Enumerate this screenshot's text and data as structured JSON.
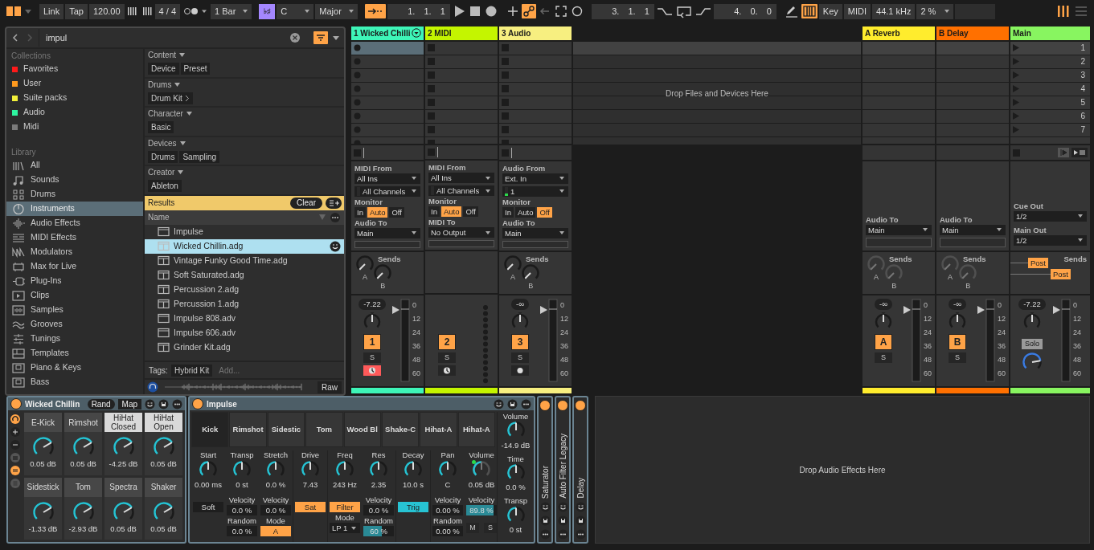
{
  "transport": [
    {
      "items": [
        {
          "kind": "icon",
          "on": true
        },
        {
          "kind": "icon"
        }
      ]
    },
    {
      "items": [
        {
          "kind": "button",
          "label": "Link"
        },
        {
          "kind": "button",
          "label": "Tap"
        },
        {
          "kind": "field",
          "label": "120.00"
        },
        {
          "kind": "icon"
        },
        {
          "kind": "icon"
        },
        {
          "kind": "field",
          "label": "4 / 4"
        },
        {
          "kind": "icon"
        },
        {
          "kind": "dropdown",
          "label": "1 Bar"
        }
      ]
    },
    {
      "items": [
        {
          "kind": "scale",
          "label": "♭♯",
          "on": true
        },
        {
          "kind": "dropdown",
          "label": "C"
        },
        {
          "kind": "dropdown",
          "label": "Major"
        }
      ]
    },
    {
      "items": [
        {
          "kind": "icon",
          "on": true
        },
        {
          "kind": "position",
          "label": "1. 1. 1"
        },
        {
          "kind": "icon"
        },
        {
          "kind": "icon"
        },
        {
          "kind": "icon"
        }
      ]
    },
    {
      "items": [
        {
          "kind": "icon"
        },
        {
          "kind": "icon",
          "on": true
        },
        {
          "kind": "icon"
        },
        {
          "kind": "icon"
        },
        {
          "kind": "icon"
        }
      ]
    },
    {
      "items": [
        {
          "kind": "position",
          "label": "3. 1. 1"
        },
        {
          "kind": "icon"
        },
        {
          "kind": "icon"
        },
        {
          "kind": "icon"
        },
        {
          "kind": "position",
          "label": "4. 0. 0"
        }
      ]
    },
    {
      "items": [
        {
          "kind": "icon"
        },
        {
          "kind": "icon",
          "on": true
        },
        {
          "kind": "button",
          "label": "Key"
        },
        {
          "kind": "button",
          "label": "MIDI"
        },
        {
          "kind": "field",
          "label": "44.1 kHz"
        },
        {
          "kind": "dropdown",
          "label": "2 %"
        },
        {
          "kind": "blank"
        }
      ]
    },
    {
      "items": [
        {
          "kind": "icon",
          "on": true
        },
        {
          "kind": "icon"
        }
      ]
    }
  ],
  "browser": {
    "search": {
      "value": "impul"
    },
    "filter_toggle": {
      "on": true
    },
    "collections": {
      "title": "Collections",
      "items": [
        {
          "label": "Favorites",
          "color": "#ff1a1a"
        },
        {
          "label": "User",
          "color": "#ff9a1e"
        },
        {
          "label": "Suite packs",
          "color": "#f2f03a"
        },
        {
          "label": "Audio",
          "color": "#2ef5a0"
        },
        {
          "label": "Midi",
          "color": "#7a7a7a"
        }
      ]
    },
    "library": {
      "title": "Library",
      "items": [
        {
          "label": "All",
          "selected": false
        },
        {
          "label": "Sounds",
          "selected": false
        },
        {
          "label": "Drums",
          "selected": false
        },
        {
          "label": "Instruments",
          "selected": true
        },
        {
          "label": "Audio Effects",
          "selected": false
        },
        {
          "label": "MIDI Effects",
          "selected": false
        },
        {
          "label": "Modulators",
          "selected": false
        },
        {
          "label": "Max for Live",
          "selected": false
        },
        {
          "label": "Plug-Ins",
          "selected": false
        },
        {
          "label": "Clips",
          "selected": false
        },
        {
          "label": "Samples",
          "selected": false
        },
        {
          "label": "Grooves",
          "selected": false
        },
        {
          "label": "Tunings",
          "selected": false
        },
        {
          "label": "Templates",
          "selected": false
        },
        {
          "label": "Piano & Keys",
          "selected": false
        },
        {
          "label": "Bass",
          "selected": false
        }
      ]
    },
    "filters": [
      {
        "title": "Content",
        "tags": [
          {
            "label": "Device",
            "expandable": false
          },
          {
            "label": "Preset",
            "expandable": false
          }
        ]
      },
      {
        "title": "Drums",
        "tags": [
          {
            "label": "Drum Kit",
            "expandable": true
          }
        ]
      },
      {
        "title": "Character",
        "tags": [
          {
            "label": "Basic",
            "expandable": false
          }
        ]
      },
      {
        "title": "Devices",
        "tags": [
          {
            "label": "Drums",
            "expandable": false
          },
          {
            "label": "Sampling",
            "expandable": false
          }
        ]
      },
      {
        "title": "Creator",
        "tags": [
          {
            "label": "Ableton",
            "expandable": false
          }
        ]
      }
    ],
    "results": {
      "title": "Results",
      "clear": "Clear",
      "column": "Name",
      "items": [
        {
          "label": "Impulse",
          "kind": "device",
          "selected": false
        },
        {
          "label": "Wicked Chillin.adg",
          "kind": "rack",
          "selected": true
        },
        {
          "label": "Vintage Funky Good Time.adg",
          "kind": "rack",
          "selected": false
        },
        {
          "label": "Soft Saturated.adg",
          "kind": "rack",
          "selected": false
        },
        {
          "label": "Percussion 2.adg",
          "kind": "rack",
          "selected": false
        },
        {
          "label": "Percussion 1.adg",
          "kind": "rack",
          "selected": false
        },
        {
          "label": "Impulse 808.adv",
          "kind": "device",
          "selected": false
        },
        {
          "label": "Impulse 606.adv",
          "kind": "device",
          "selected": false
        },
        {
          "label": "Grinder Kit.adg",
          "kind": "rack",
          "selected": false
        }
      ]
    },
    "tags": {
      "label": "Tags:",
      "items": [
        "Hybrid Kit"
      ],
      "placeholder": "Add..."
    },
    "preview": {
      "raw": "Raw"
    }
  },
  "session": {
    "tracks": [
      {
        "name": "1 Wicked Chilli",
        "color": "#3ef5b8",
        "kind": "midi-instrument",
        "armed": true,
        "slots": [
          {
            "selected": true
          },
          {
            "selected": false
          },
          {
            "selected": false
          },
          {
            "selected": false
          },
          {
            "selected": false
          },
          {
            "selected": false
          },
          {
            "selected": false
          },
          {
            "selected": false
          }
        ],
        "io": {
          "from_label": "MIDI From",
          "from": "All Ins",
          "channel": "All Channels",
          "monitor_label": "Monitor",
          "monitor": [
            {
              "label": "In",
              "selected": false
            },
            {
              "label": "Auto",
              "selected": true
            },
            {
              "label": "Off",
              "selected": false
            }
          ],
          "to_label": "Audio To",
          "to": "Main"
        },
        "sends": {
          "label": "Sends",
          "knobs": [
            {
              "label": "A"
            },
            {
              "label": "B"
            }
          ]
        },
        "volume": "-7.22",
        "number": "1",
        "solo": "S",
        "scale": [
          "0",
          "12",
          "24",
          "36",
          "48",
          "60"
        ]
      },
      {
        "name": "2 MIDI",
        "color": "#c4f500",
        "kind": "midi",
        "armed": false,
        "slots": [
          {
            "selected": false
          },
          {
            "selected": false
          },
          {
            "selected": false
          },
          {
            "selected": false
          },
          {
            "selected": false
          },
          {
            "selected": false
          },
          {
            "selected": false
          },
          {
            "selected": false
          }
        ],
        "io": {
          "from_label": "MIDI From",
          "from": "All Ins",
          "channel": "All Channels",
          "monitor_label": "Monitor",
          "monitor": [
            {
              "label": "In",
              "selected": false
            },
            {
              "label": "Auto",
              "selected": true
            },
            {
              "label": "Off",
              "selected": false
            }
          ],
          "to_label": "MIDI To",
          "to": "No Output"
        },
        "number": "2",
        "solo": "S"
      },
      {
        "name": "3 Audio",
        "color": "#f7ef80",
        "kind": "audio",
        "armed": false,
        "slots": [
          {
            "selected": false
          },
          {
            "selected": false
          },
          {
            "selected": false
          },
          {
            "selected": false
          },
          {
            "selected": false
          },
          {
            "selected": false
          },
          {
            "selected": false
          },
          {
            "selected": false
          }
        ],
        "io": {
          "from_label": "Audio From",
          "from": "Ext. In",
          "channel": "1",
          "monitor_label": "Monitor",
          "monitor": [
            {
              "label": "In",
              "selected": false
            },
            {
              "label": "Auto",
              "selected": false
            },
            {
              "label": "Off",
              "selected": true
            }
          ],
          "to_label": "Audio To",
          "to": "Main"
        },
        "sends": {
          "label": "Sends",
          "knobs": [
            {
              "label": "A"
            },
            {
              "label": "B"
            }
          ]
        },
        "volume": "-∞",
        "number": "3",
        "solo": "S",
        "scale": [
          "0",
          "12",
          "24",
          "36",
          "48",
          "60"
        ]
      }
    ],
    "drop_hint": "Drop Files and Devices Here",
    "returns": [
      {
        "name": "A Reverb",
        "color": "#ffec2d",
        "io": {
          "to_label": "Audio To",
          "to": "Main"
        },
        "sends": {
          "label": "Sends",
          "knobs": [
            {
              "label": "A"
            },
            {
              "label": "B"
            }
          ]
        },
        "volume": "-∞",
        "letter": "A",
        "solo": "S",
        "scale": [
          "0",
          "12",
          "24",
          "36",
          "48",
          "60"
        ]
      },
      {
        "name": "B Delay",
        "color": "#ff7000",
        "io": {
          "to_label": "Audio To",
          "to": "Main"
        },
        "sends": {
          "label": "Sends",
          "knobs": [
            {
              "label": "A"
            },
            {
              "label": "B"
            }
          ]
        },
        "volume": "-∞",
        "letter": "B",
        "solo": "S",
        "scale": [
          "0",
          "12",
          "24",
          "36",
          "48",
          "60"
        ]
      }
    ],
    "main": {
      "name": "Main",
      "color": "#88f560",
      "scenes": [
        {
          "label": "1",
          "selected": true
        },
        {
          "label": "2",
          "selected": false
        },
        {
          "label": "3",
          "selected": false
        },
        {
          "label": "4",
          "selected": false
        },
        {
          "label": "5",
          "selected": false
        },
        {
          "label": "6",
          "selected": false
        },
        {
          "label": "7",
          "selected": false
        }
      ],
      "cue_label": "Cue Out",
      "cue": "1/2",
      "out_label": "Main Out",
      "out": "1/2",
      "sends_label": "Sends",
      "posts": [
        "Post",
        "Post"
      ],
      "volume": "-7.22",
      "solo": "Solo",
      "scale": [
        "0",
        "12",
        "24",
        "36",
        "48",
        "60"
      ]
    }
  },
  "devices": {
    "rack": {
      "title": "Wicked Chillin",
      "on": true,
      "rand": "Rand",
      "map": "Map",
      "pads": [
        {
          "label": "E-Kick",
          "value": "0.05 dB",
          "selected": false
        },
        {
          "label": "Rimshot",
          "value": "0.05 dB",
          "selected": false
        },
        {
          "label": "HiHat Closed",
          "value": "-4.25 dB",
          "selected": true
        },
        {
          "label": "HiHat Open",
          "value": "0.05 dB",
          "selected": true
        },
        {
          "label": "Sidestick",
          "value": "-1.33 dB",
          "selected": false
        },
        {
          "label": "Tom",
          "value": "-2.93 dB",
          "selected": false
        },
        {
          "label": "Spectra",
          "value": "0.05 dB",
          "selected": false
        },
        {
          "label": "Shaker",
          "value": "0.05 dB",
          "selected": false
        }
      ]
    },
    "impulse": {
      "title": "Impulse",
      "on": true,
      "pads": [
        {
          "label": "Kick",
          "selected": true
        },
        {
          "label": "Rimshot",
          "selected": false
        },
        {
          "label": "Sidestic",
          "selected": false
        },
        {
          "label": "Tom",
          "selected": false
        },
        {
          "label": "Wood Bl",
          "selected": false
        },
        {
          "label": "Shake-C",
          "selected": false
        },
        {
          "label": "Hihat-A",
          "selected": false
        },
        {
          "label": "Hihat-A",
          "selected": false
        }
      ],
      "sections": [
        {
          "columns": [
            [
              {
                "kind": "knob",
                "label": "Start",
                "reading": "0.00 ms"
              },
              {
                "kind": "toggle",
                "label": "Soft",
                "on": false
              }
            ],
            [
              {
                "kind": "knob",
                "label": "Transp",
                "reading": "0 st"
              },
              {
                "kind": "field",
                "label": "Velocity",
                "value": "0.0 %"
              },
              {
                "kind": "field",
                "label": "Random",
                "value": "0.0 %"
              }
            ],
            [
              {
                "kind": "knob",
                "label": "Stretch",
                "reading": "0.0 %"
              },
              {
                "kind": "field",
                "label": "Velocity",
                "value": "0.0 %"
              },
              {
                "kind": "choice",
                "label": "Mode",
                "value": "A",
                "on": true
              }
            ]
          ]
        },
        {
          "columns": [
            [
              {
                "kind": "knob",
                "label": "Drive",
                "reading": "7.43"
              },
              {
                "kind": "toggle",
                "label": "Sat",
                "on": true
              }
            ]
          ]
        },
        {
          "columns": [
            [
              {
                "kind": "knob",
                "label": "Freq",
                "reading": "243 Hz"
              },
              {
                "kind": "toggle",
                "label": "Filter",
                "on": true
              },
              {
                "kind": "dropdown",
                "label": "Mode",
                "value": "LP 1"
              }
            ],
            [
              {
                "kind": "knob",
                "label": "Res",
                "reading": "2.35"
              },
              {
                "kind": "field",
                "label": "Velocity",
                "value": "0.0 %"
              },
              {
                "kind": "meter",
                "label": "Random",
                "value": "60 %",
                "level": 0.6
              }
            ]
          ]
        },
        {
          "columns": [
            [
              {
                "kind": "knob",
                "label": "Decay",
                "reading": "10.0 s"
              },
              {
                "kind": "trigger",
                "label": "Trig",
                "on": true
              }
            ]
          ]
        },
        {
          "columns": [
            [
              {
                "kind": "knob",
                "label": "Pan",
                "reading": "C"
              },
              {
                "kind": "field",
                "label": "Velocity",
                "value": "0.00 %"
              },
              {
                "kind": "field",
                "label": "Random",
                "value": "0.00 %"
              }
            ],
            [
              {
                "kind": "knob",
                "label": "Volume",
                "reading": "0.05 dB",
                "led": true
              },
              {
                "kind": "meter",
                "label": "Velocity",
                "value": "89.8 %",
                "level": 0.898
              },
              {
                "kind": "pair",
                "labels": [
                  "M",
                  "S"
                ]
              }
            ]
          ]
        }
      ],
      "global": [
        {
          "label": "Volume",
          "reading": "-14.9 dB"
        },
        {
          "label": "Time",
          "reading": "0.0 %"
        },
        {
          "label": "Transp",
          "reading": "0 st"
        }
      ]
    },
    "collapsed": [
      {
        "title": "Saturator",
        "on": true
      },
      {
        "title": "Auto Filter Legacy",
        "on": true
      },
      {
        "title": "Delay",
        "on": true
      }
    ],
    "drop_hint": "Drop Audio Effects Here"
  }
}
